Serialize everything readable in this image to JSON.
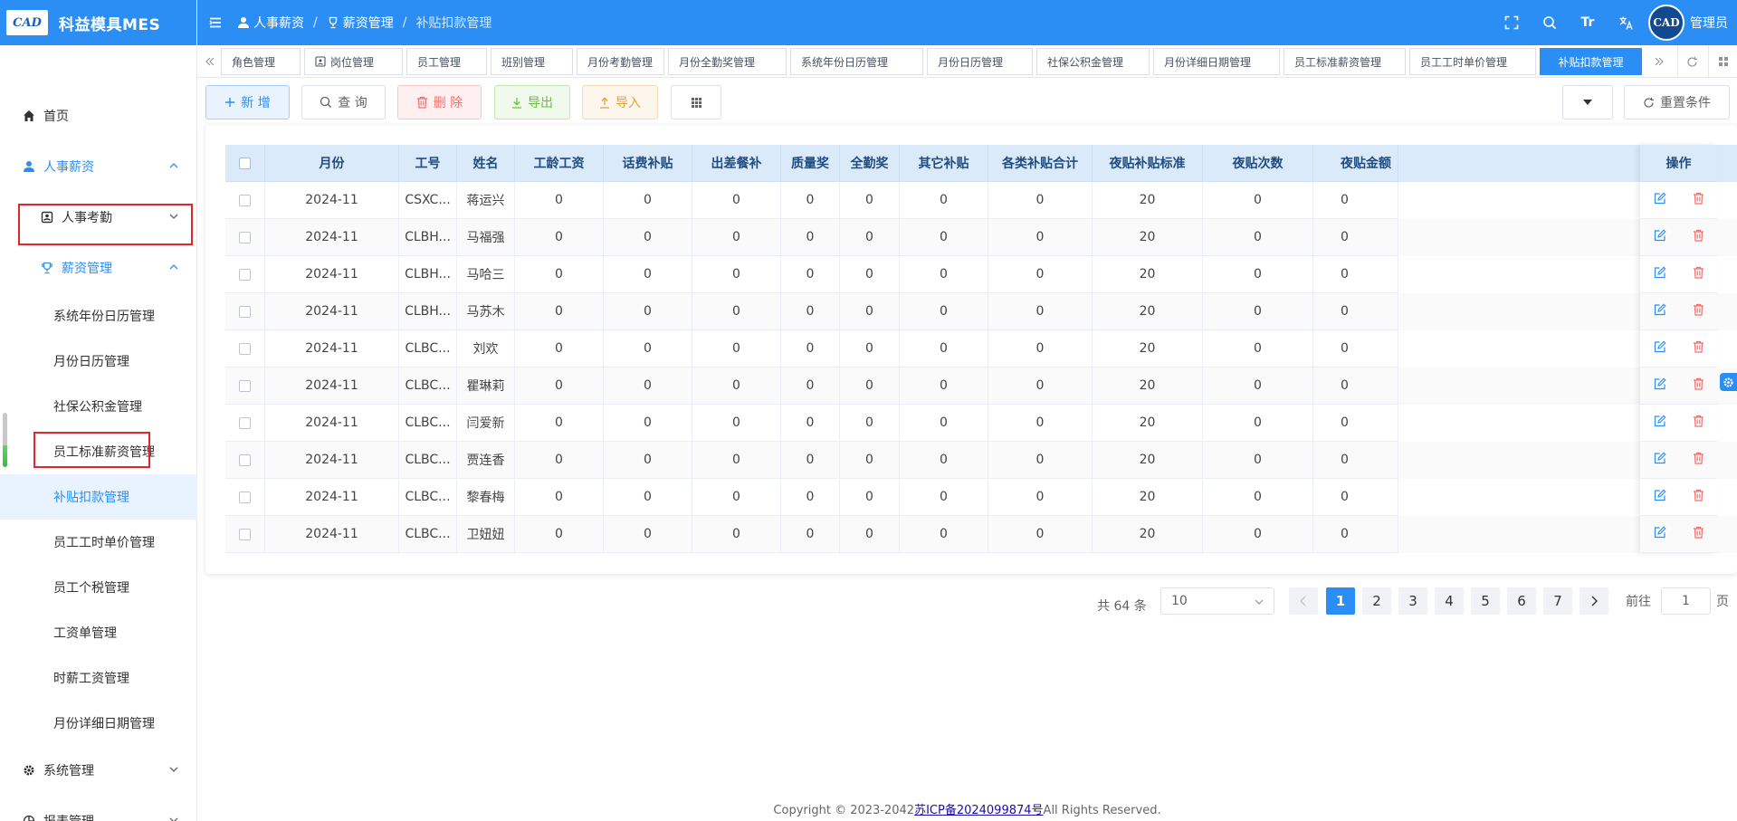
{
  "app": {
    "logo_text": "CAD",
    "title": "科益模具MES"
  },
  "sidebar": {
    "home": "首页",
    "hr_salary": "人事薪资",
    "hr_attendance": "人事考勤",
    "salary_mgmt": "薪资管理",
    "sub_items": [
      "系统年份日历管理",
      "月份日历管理",
      "社保公积金管理",
      "员工标准薪资管理",
      "补贴扣款管理",
      "员工工时单价管理",
      "员工个税管理",
      "工资单管理",
      "时薪工资管理",
      "月份详细日期管理"
    ],
    "system_mgmt": "系统管理",
    "report_mgmt": "报表管理"
  },
  "header": {
    "breadcrumb": [
      "人事薪资",
      "薪资管理",
      "补贴扣款管理"
    ],
    "avatar_text": "CAD",
    "font_icon_text": "Tr",
    "user": "管理员"
  },
  "tabs": [
    {
      "label": "角色管理",
      "icon": ""
    },
    {
      "label": "岗位管理",
      "icon": "id-card-icon"
    },
    {
      "label": "员工管理",
      "icon": ""
    },
    {
      "label": "班别管理",
      "icon": ""
    },
    {
      "label": "月份考勤管理",
      "icon": ""
    },
    {
      "label": "月份全勤奖管理",
      "icon": ""
    },
    {
      "label": "系统年份日历管理",
      "icon": ""
    },
    {
      "label": "月份日历管理",
      "icon": ""
    },
    {
      "label": "社保公积金管理",
      "icon": ""
    },
    {
      "label": "月份详细日期管理",
      "icon": ""
    },
    {
      "label": "员工标准薪资管理",
      "icon": ""
    },
    {
      "label": "员工工时单价管理",
      "icon": ""
    },
    {
      "label": "补贴扣款管理",
      "icon": "",
      "active": true
    }
  ],
  "toolbar": {
    "add": "新 增",
    "query": "查 询",
    "delete": "删 除",
    "export": "导出",
    "import": "导入",
    "reset": "重置条件"
  },
  "table": {
    "columns": [
      "月份",
      "工号",
      "姓名",
      "工龄工资",
      "话费补贴",
      "出差餐补",
      "质量奖",
      "全勤奖",
      "其它补贴",
      "各类补贴合计",
      "夜贴补贴标准",
      "夜贴次数",
      "夜贴金额"
    ],
    "op_header": "操作",
    "rows": [
      [
        "2024-11",
        "CSXC...",
        "蒋运兴",
        "0",
        "0",
        "0",
        "0",
        "0",
        "0",
        "0",
        "20",
        "0",
        "0"
      ],
      [
        "2024-11",
        "CLBH...",
        "马福强",
        "0",
        "0",
        "0",
        "0",
        "0",
        "0",
        "0",
        "20",
        "0",
        "0"
      ],
      [
        "2024-11",
        "CLBH...",
        "马哈三",
        "0",
        "0",
        "0",
        "0",
        "0",
        "0",
        "0",
        "20",
        "0",
        "0"
      ],
      [
        "2024-11",
        "CLBH...",
        "马苏木",
        "0",
        "0",
        "0",
        "0",
        "0",
        "0",
        "0",
        "20",
        "0",
        "0"
      ],
      [
        "2024-11",
        "CLBC...",
        "刘欢",
        "0",
        "0",
        "0",
        "0",
        "0",
        "0",
        "0",
        "20",
        "0",
        "0"
      ],
      [
        "2024-11",
        "CLBC...",
        "瞿琳莉",
        "0",
        "0",
        "0",
        "0",
        "0",
        "0",
        "0",
        "20",
        "0",
        "0"
      ],
      [
        "2024-11",
        "CLBC...",
        "闫爱新",
        "0",
        "0",
        "0",
        "0",
        "0",
        "0",
        "0",
        "20",
        "0",
        "0"
      ],
      [
        "2024-11",
        "CLBC...",
        "贾连香",
        "0",
        "0",
        "0",
        "0",
        "0",
        "0",
        "0",
        "20",
        "0",
        "0"
      ],
      [
        "2024-11",
        "CLBC...",
        "黎春梅",
        "0",
        "0",
        "0",
        "0",
        "0",
        "0",
        "0",
        "20",
        "0",
        "0"
      ],
      [
        "2024-11",
        "CLBC...",
        "卫妞妞",
        "0",
        "0",
        "0",
        "0",
        "0",
        "0",
        "0",
        "20",
        "0",
        "0"
      ]
    ]
  },
  "pagination": {
    "total": "共 64 条",
    "page_size": "10",
    "pages": [
      "1",
      "2",
      "3",
      "4",
      "5",
      "6",
      "7"
    ],
    "current": "1",
    "goto_label": "前往",
    "goto_value": "1",
    "goto_suffix": "页"
  },
  "footer": {
    "prefix": "Copyright © 2023-2042",
    "icp": "苏ICP备2024099874号",
    "suffix": "All Rights Reserved."
  },
  "colors": {
    "primary": "#2b8ef5",
    "highlight_box": "#e3262d",
    "table_header": "#dbeaf8"
  }
}
